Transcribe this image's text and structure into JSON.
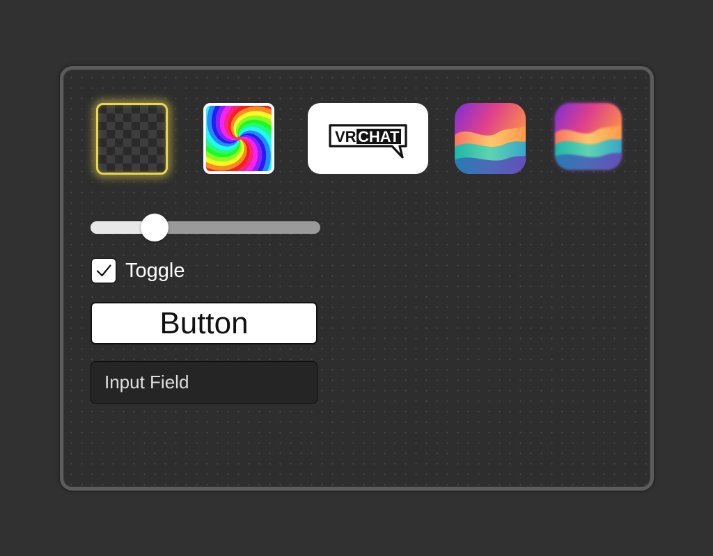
{
  "tiles": [
    {
      "icon": "checkerboard-transparent-icon"
    },
    {
      "icon": "rainbow-swirl-icon"
    },
    {
      "icon": "vrchat-logo",
      "logo_text": "VRCHAT"
    },
    {
      "icon": "gradient-wave-icon"
    },
    {
      "icon": "gradient-wave-icon"
    }
  ],
  "controls": {
    "slider": {
      "value": 0.28
    },
    "toggle": {
      "label": "Toggle",
      "checked": true,
      "check_glyph": "✓"
    },
    "button": {
      "label": "Button"
    },
    "input": {
      "placeholder": "Input Field"
    }
  },
  "colors": {
    "background": "#313131",
    "panel": "#2e2e2e",
    "panel_border": "#5c5c5c",
    "highlight": "#e9d84e",
    "slider_fill": "#e8e8e8",
    "slider_track": "#9a9a9a"
  }
}
